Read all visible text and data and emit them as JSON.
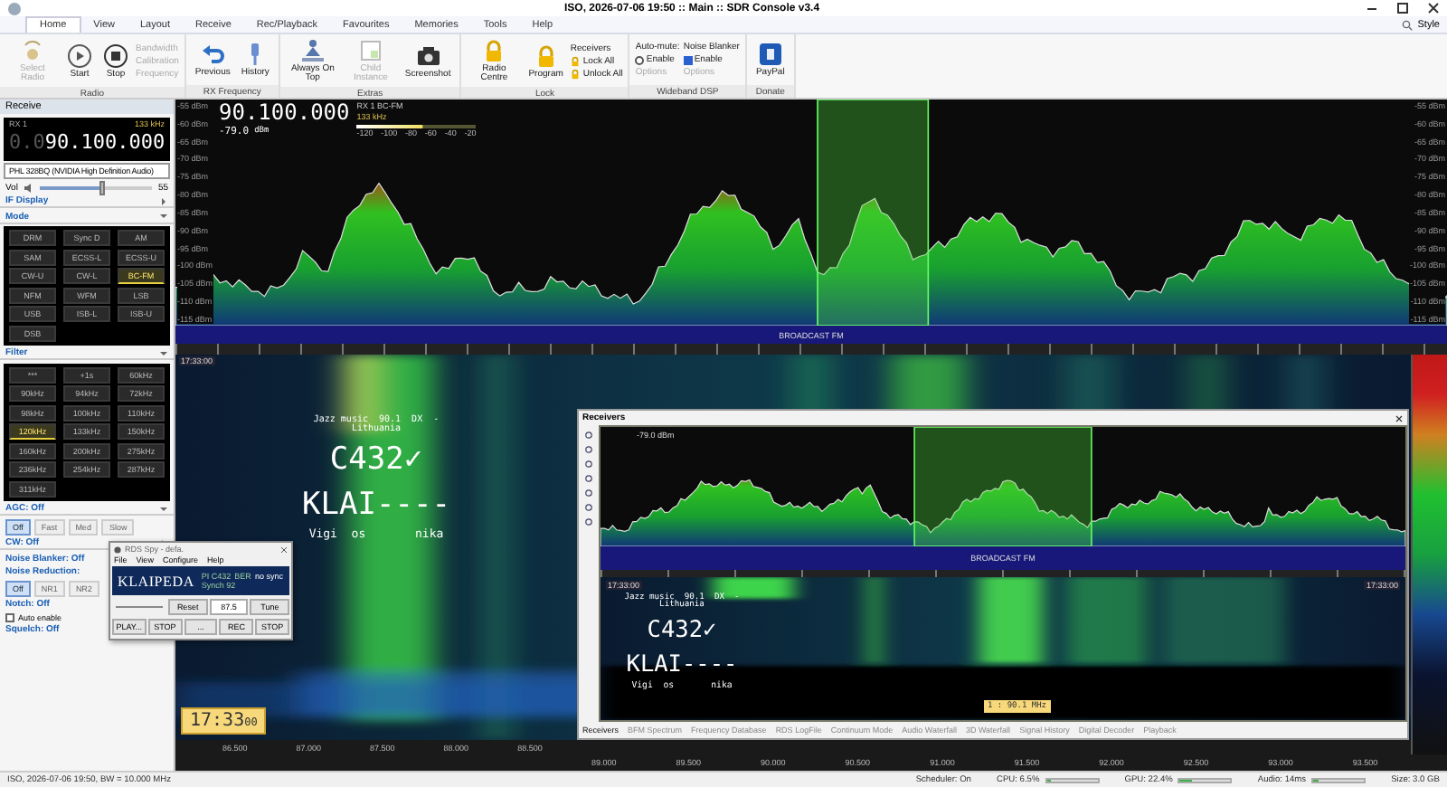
{
  "window": {
    "title": "ISO, 2026-07-06 19:50 :: Main :: SDR Console v3.4"
  },
  "menu_tabs": [
    {
      "label": "Home",
      "selected": true
    },
    {
      "label": "View",
      "selected": false
    },
    {
      "label": "Layout",
      "selected": false
    },
    {
      "label": "Receive",
      "selected": false
    },
    {
      "label": "Rec/Playback",
      "selected": false
    },
    {
      "label": "Favourites",
      "selected": false
    },
    {
      "label": "Memories",
      "selected": false
    },
    {
      "label": "Tools",
      "selected": false
    },
    {
      "label": "Help",
      "selected": false
    }
  ],
  "style_button": "Style",
  "ribbon": [
    {
      "title": "Radio",
      "items": [
        {
          "kind": "large",
          "label": "Select Radio",
          "disabled": true
        },
        {
          "kind": "large",
          "label": "Start",
          "disabled": false
        },
        {
          "kind": "large",
          "label": "Stop",
          "disabled": false
        },
        {
          "kind": "column",
          "items": [
            {
              "kind": "small",
              "label": "Bandwidth",
              "disabled": true
            },
            {
              "kind": "small",
              "label": "Calibration",
              "disabled": true
            },
            {
              "kind": "small",
              "label": "Frequency",
              "disabled": true
            }
          ]
        }
      ]
    },
    {
      "title": "RX Frequency",
      "items": [
        {
          "kind": "large",
          "label": "Previous",
          "disabled": false
        },
        {
          "kind": "large",
          "label": "History",
          "disabled": false
        }
      ]
    },
    {
      "title": "Extras",
      "items": [
        {
          "kind": "large",
          "label": "Always On Top",
          "disabled": false
        },
        {
          "kind": "large",
          "label": "Child Instance",
          "disabled": true
        },
        {
          "kind": "large",
          "label": "Screenshot",
          "disabled": false
        }
      ]
    },
    {
      "title": "Lock",
      "items": [
        {
          "kind": "large",
          "label": "Radio Centre",
          "disabled": false
        },
        {
          "kind": "large",
          "label": "Program",
          "disabled": false
        },
        {
          "kind": "column",
          "items": [
            {
              "kind": "header",
              "label": "Receivers"
            },
            {
              "kind": "lock",
              "label": "Lock All",
              "disabled": false
            },
            {
              "kind": "lock",
              "label": "Unlock All",
              "disabled": false
            }
          ]
        }
      ]
    },
    {
      "title": "Wideband DSP",
      "items": [
        {
          "kind": "column",
          "items": [
            {
              "kind": "header",
              "label": "Auto-mute:"
            },
            {
              "kind": "check",
              "label": "Enable",
              "checked": false
            },
            {
              "kind": "option",
              "label": "Options",
              "disabled": true
            }
          ]
        },
        {
          "kind": "column",
          "items": [
            {
              "kind": "header",
              "label": "Noise Blanker"
            },
            {
              "kind": "check",
              "label": "Enable",
              "checked": true
            },
            {
              "kind": "option",
              "label": "Options",
              "disabled": true
            }
          ]
        }
      ]
    },
    {
      "title": "Donate",
      "items": [
        {
          "kind": "large",
          "label": "PayPal",
          "disabled": false
        }
      ]
    }
  ],
  "receive_panel": {
    "title": "Receive",
    "display": {
      "rx": "RX 1",
      "bandwidth": "133 kHz",
      "frequency_prefix": "0.0",
      "frequency": "90.100.000"
    },
    "audio_device": "PHL 328BQ (NVIDIA High Definition Audio)",
    "volume": {
      "label": "Vol",
      "level": 0.55,
      "reading": "55"
    },
    "if_display": {
      "title": "IF Display",
      "expanded": false
    },
    "mode": {
      "title": "Mode",
      "expanded": true,
      "buttons": [
        {
          "label": "DRM",
          "selected": false
        },
        {
          "label": "Sync D",
          "selected": false
        },
        {
          "label": "AM",
          "selected": false
        },
        {
          "label": "SAM",
          "selected": false
        },
        {
          "label": "ECSS-L",
          "selected": false
        },
        {
          "label": "ECSS-U",
          "selected": false
        },
        {
          "label": "CW-U",
          "selected": false
        },
        {
          "label": "CW-L",
          "selected": false
        },
        {
          "label": "BC-FM",
          "selected": true
        },
        {
          "label": "NFM",
          "selected": false
        },
        {
          "label": "WFM",
          "selected": false
        },
        {
          "label": "LSB",
          "selected": false
        },
        {
          "label": "USB",
          "selected": false
        },
        {
          "label": "ISB-L",
          "selected": false
        },
        {
          "label": "ISB-U",
          "selected": false
        },
        {
          "label": "DSB",
          "selected": false
        }
      ]
    },
    "filter": {
      "title": "Filter",
      "expanded": true,
      "buttons": [
        {
          "label": "***",
          "selected": false
        },
        {
          "label": "+1s",
          "selected": false
        },
        {
          "label": "60kHz",
          "selected": false
        },
        {
          "label": "90kHz",
          "selected": false
        },
        {
          "label": "94kHz",
          "selected": false
        },
        {
          "label": "72kHz",
          "selected": false
        },
        {
          "label": "98kHz",
          "selected": false
        },
        {
          "label": "100kHz",
          "selected": false
        },
        {
          "label": "110kHz",
          "selected": false
        },
        {
          "label": "120kHz",
          "selected": true
        },
        {
          "label": "133kHz",
          "selected": false
        },
        {
          "label": "150kHz",
          "selected": false
        },
        {
          "label": "160kHz",
          "selected": false
        },
        {
          "label": "200kHz",
          "selected": false
        },
        {
          "label": "275kHz",
          "selected": false
        },
        {
          "label": "236kHz",
          "selected": false
        },
        {
          "label": "254kHz",
          "selected": false
        },
        {
          "label": "287kHz",
          "selected": false
        },
        {
          "label": "311kHz",
          "selected": false
        }
      ]
    },
    "agc": {
      "title": "AGC: Off",
      "expanded": true,
      "buttons": [
        {
          "label": "Off",
          "selected": true
        },
        {
          "label": "Fast",
          "selected": false
        },
        {
          "label": "Med",
          "selected": false
        },
        {
          "label": "Slow",
          "selected": false
        }
      ]
    },
    "cw": {
      "title": "CW: Off",
      "expanded": false
    },
    "noise_blanker": {
      "title": "Noise Blanker: Off"
    },
    "noise_reduction": {
      "title": "Noise Reduction:",
      "buttons": [
        {
          "label": "Off",
          "selected": true
        },
        {
          "label": "NR1",
          "selected": false
        },
        {
          "label": "NR2",
          "selected": false
        }
      ]
    },
    "notch": {
      "title": "Notch: Off",
      "auto_enable": {
        "label": "Auto enable",
        "checked": false
      }
    },
    "squelch": {
      "title": "Squelch: Off"
    }
  },
  "spectrum": {
    "frequency": "90.100.000",
    "level_reading": "-79.0",
    "level_unit": "dBm",
    "rx": "RX 1",
    "mode": "BC-FM",
    "bandwidth": "133 kHz",
    "meter_scale": [
      "-120",
      "-100",
      "-80",
      "-60",
      "-40",
      "-20"
    ],
    "scale_labels_left": [
      "-55 dBm",
      "-60 dBm",
      "-65 dBm",
      "-70 dBm",
      "-75 dBm",
      "-80 dBm",
      "-85 dBm",
      "-90 dBm",
      "-95 dBm",
      "-100 dBm",
      "-105 dBm",
      "-110 dBm",
      "-115 dBm"
    ],
    "scale_labels_right": [
      "-55 dBm",
      "-60 dBm",
      "-65 dBm",
      "-70 dBm",
      "-75 dBm",
      "-80 dBm",
      "-85 dBm",
      "-90 dBm",
      "-95 dBm",
      "-100 dBm",
      "-105 dBm",
      "-110 dBm",
      "-115 dBm"
    ],
    "band_label": "BROADCAST FM"
  },
  "waterfall": {
    "time": "17:33:00",
    "overlay_lines": [
      {
        "kind": "small",
        "text": "Jazz music  90.1  DX  -"
      },
      {
        "kind": "small",
        "text": "Lithuania"
      },
      {
        "kind": "large",
        "text": "C432✓"
      },
      {
        "kind": "large",
        "text": "KLAI----"
      },
      {
        "kind": "medium",
        "text": "Vigi  os       nika"
      }
    ],
    "clock": {
      "time": "17:33",
      "seconds": "00"
    },
    "axis": [
      "86.500",
      "87.000",
      "87.500",
      "88.000",
      "88.500"
    ]
  },
  "rds_spy": {
    "title": "RDS Spy - defa.",
    "menu": [
      "File",
      "View",
      "Configure",
      "Help"
    ],
    "ps": "KLAIPEDA",
    "pi": "PI C432",
    "ber": "BER",
    "sync": "no sync",
    "signal": "Synch 92",
    "reset": "Reset",
    "frequency": "87.5",
    "tune": "Tune",
    "buttons": [
      "PLAY...",
      "STOP",
      "...",
      "REC",
      "STOP"
    ]
  },
  "receivers": {
    "title": "Receivers",
    "level_reading": "-79.0 dBm",
    "band_label": "BROADCAST FM",
    "time_left": "17:33:00",
    "time_right": "17:33:00",
    "overlay_lines": [
      {
        "kind": "small",
        "text": "Jazz music  90.1  DX  -"
      },
      {
        "kind": "small",
        "text": "Lithuania"
      },
      {
        "kind": "large",
        "text": "C432✓"
      },
      {
        "kind": "large",
        "text": "KLAI----"
      },
      {
        "kind": "medium",
        "text": "Vigi  os       nika"
      }
    ],
    "marker": "1 : 90.1 MHz",
    "tabs": [
      {
        "label": "Receivers",
        "selected": true
      },
      {
        "label": "BFM Spectrum",
        "selected": false
      },
      {
        "label": "Frequency Database",
        "selected": false
      },
      {
        "label": "RDS LogFile",
        "selected": false
      },
      {
        "label": "Continuum Mode",
        "selected": false
      },
      {
        "label": "Audio Waterfall",
        "selected": false
      },
      {
        "label": "3D Waterfall",
        "selected": false
      },
      {
        "label": "Signal History",
        "selected": false
      },
      {
        "label": "Digital Decoder",
        "selected": false
      },
      {
        "label": "Playback",
        "selected": false
      }
    ]
  },
  "frequency_strip": [
    "89.000",
    "89.500",
    "90.000",
    "90.500",
    "91.000",
    "91.500",
    "92.000",
    "92.500",
    "93.000",
    "93.500"
  ],
  "status_bar": {
    "left": "ISO, 2026-07-06 19:50, BW = 10.000 MHz",
    "items": [
      {
        "kind": "text",
        "label": "Scheduler: On"
      },
      {
        "kind": "meter",
        "label": "CPU: 6.5%",
        "level": 0.07
      },
      {
        "kind": "meter",
        "label": "GPU: 22.4%",
        "level": 0.22
      },
      {
        "kind": "meter",
        "label": "Audio: 14ms",
        "level": 0.1
      },
      {
        "kind": "text",
        "label": "Size: 3.0 GB"
      }
    ]
  }
}
